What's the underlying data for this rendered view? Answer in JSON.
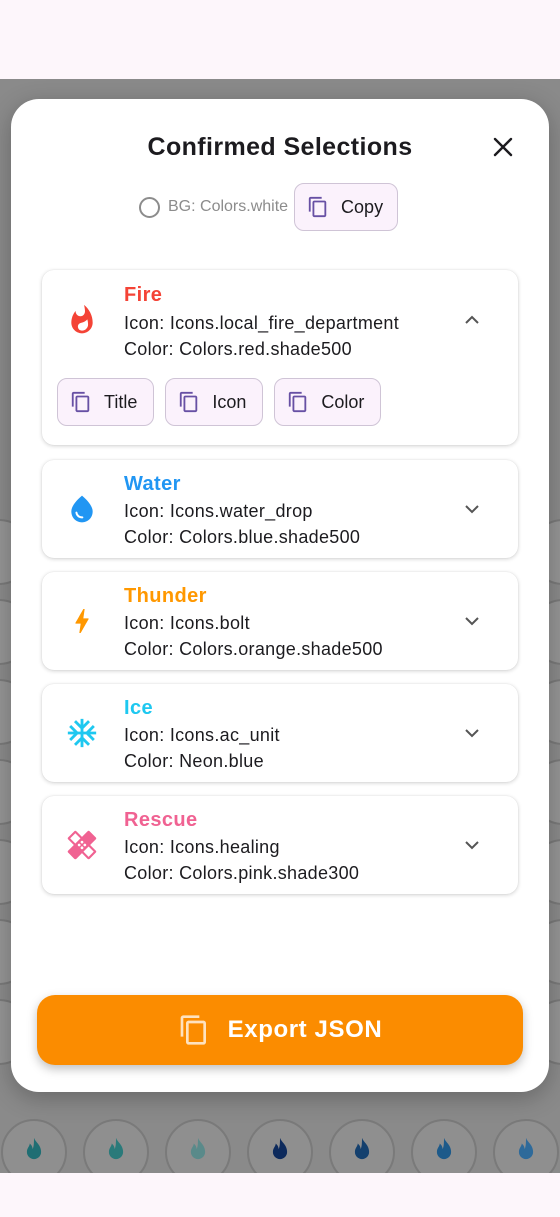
{
  "dialog": {
    "title": "Confirmed Selections",
    "close_icon": "close-icon",
    "background": {
      "label": "BG: Colors.white",
      "copy_label": "Copy"
    }
  },
  "items": [
    {
      "title": "Fire",
      "icon_line": "Icon: Icons.local_fire_department",
      "color_line": "Color: Colors.red.shade500",
      "color": "#f44336",
      "icon": "fire-icon",
      "expanded": true,
      "actions": {
        "title": "Title",
        "icon": "Icon",
        "color": "Color"
      }
    },
    {
      "title": "Water",
      "icon_line": "Icon: Icons.water_drop",
      "color_line": "Color: Colors.blue.shade500",
      "color": "#2196f3",
      "icon": "water-drop-icon",
      "expanded": false
    },
    {
      "title": "Thunder",
      "icon_line": "Icon: Icons.bolt",
      "color_line": "Color: Colors.orange.shade500",
      "color": "#ff9800",
      "icon": "bolt-icon",
      "expanded": false
    },
    {
      "title": "Ice",
      "icon_line": "Icon: Icons.ac_unit",
      "color_line": "Color: Neon.blue",
      "color": "#1ec8f0",
      "icon": "snowflake-icon",
      "expanded": false
    },
    {
      "title": "Rescue",
      "icon_line": "Icon: Icons.healing",
      "color_line": "Color: Colors.pink.shade300",
      "color": "#f06292",
      "icon": "bandage-icon",
      "expanded": false
    }
  ],
  "export": {
    "label": "Export JSON",
    "color": "#fb8c00"
  },
  "colors": {
    "accent": "#fb8c00",
    "chip_bg": "#fbf2fc",
    "chip_border": "#cfc4d6",
    "chip_icon": "#6750a4"
  }
}
